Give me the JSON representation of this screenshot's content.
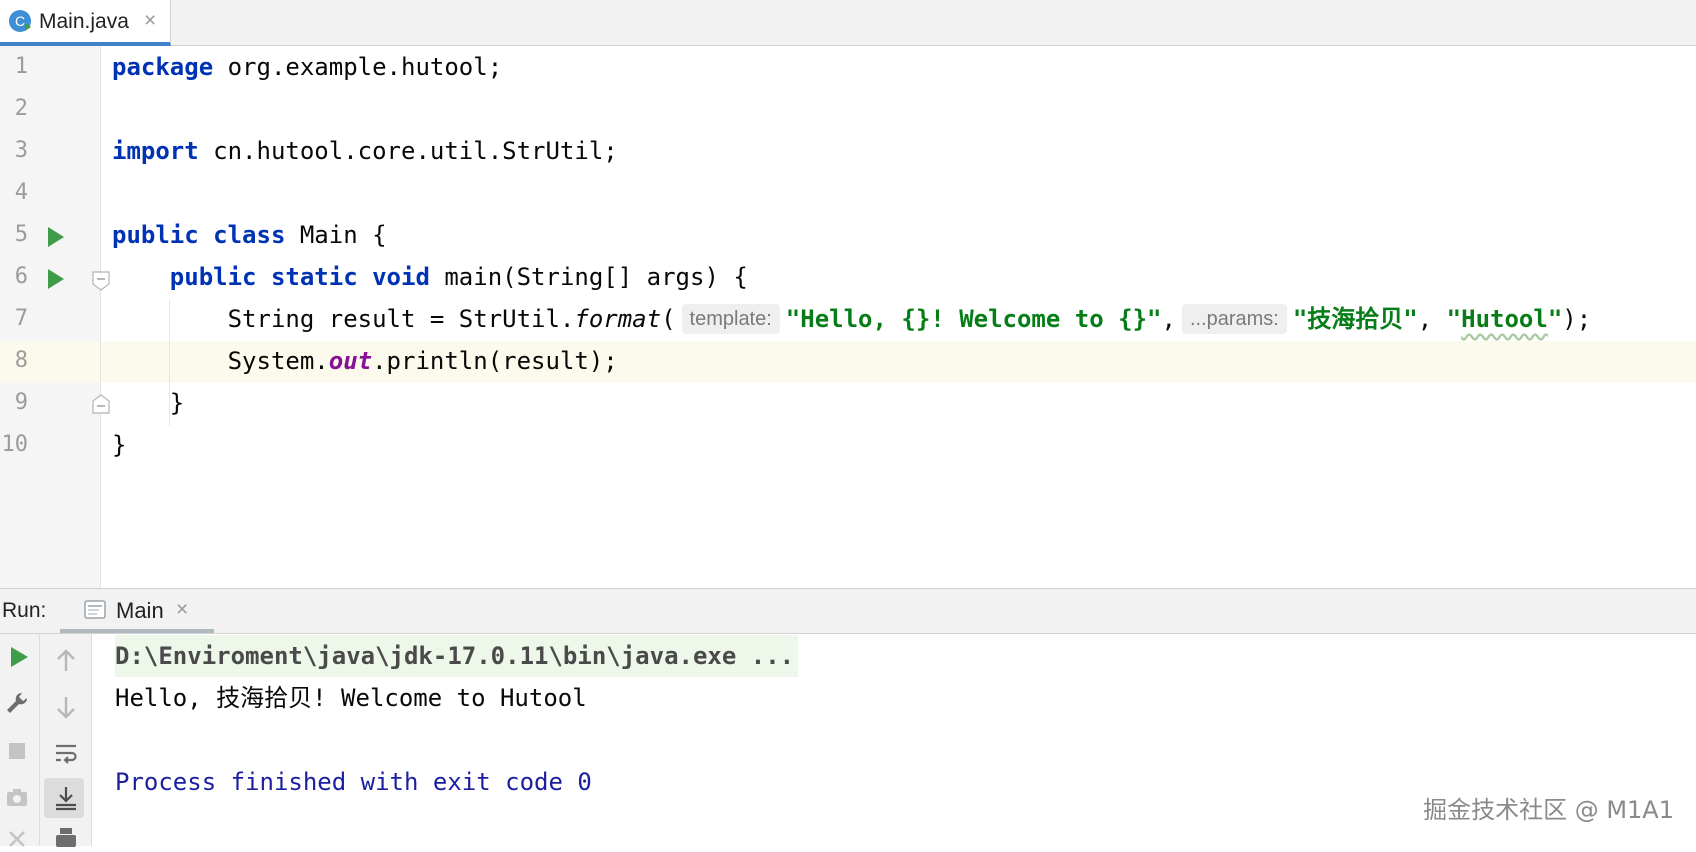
{
  "editor_tab": {
    "title": "Main.java",
    "close": "×",
    "icon_letter": "C"
  },
  "editor": {
    "line_numbers": [
      "1",
      "2",
      "3",
      "4",
      "5",
      "6",
      "7",
      "8",
      "9",
      "10"
    ],
    "lines": {
      "l1_kw": "package",
      "l1_rest": " org.example.hutool;",
      "l3_kw": "import",
      "l3_rest": " cn.hutool.core.util.StrUtil;",
      "l5_kw1": "public",
      "l5_kw2": "class",
      "l5_rest": " Main {",
      "l6_indent": "    ",
      "l6_kw1": "public",
      "l6_kw2": "static",
      "l6_kw3": "void",
      "l6_rest": " main(String[] args) {",
      "l7_pre": "        String result = StrUtil.",
      "l7_method": "format",
      "l7_paren": "(",
      "l7_hint1": "template:",
      "l7_str1": "\"Hello, {}! Welcome to {}\"",
      "l7_comma": ",",
      "l7_hint2": "...params:",
      "l7_str2": "\"技海拾贝\"",
      "l7_comma2": ", ",
      "l7_str3a": "\"",
      "l7_str3b": "Hutool",
      "l7_str3c": "\"",
      "l7_end": ");",
      "l8_pre": "        System.",
      "l8_field": "out",
      "l8_rest": ".println(result);",
      "l9": "    }",
      "l10": "}"
    }
  },
  "run_window": {
    "label": "Run:",
    "tab_title": "Main",
    "tab_close": "×",
    "console": {
      "command": "D:\\Enviroment\\java\\jdk-17.0.11\\bin\\java.exe ...",
      "output": "Hello, 技海拾贝! Welcome to Hutool",
      "exit": "Process finished with exit code 0"
    }
  },
  "watermark": "掘金技术社区 @ M1A1",
  "colors": {
    "accent_tab": "#4083c9",
    "keyword": "#0033b3",
    "string": "#067d17",
    "field": "#871094",
    "run_green": "#3f9c48"
  }
}
